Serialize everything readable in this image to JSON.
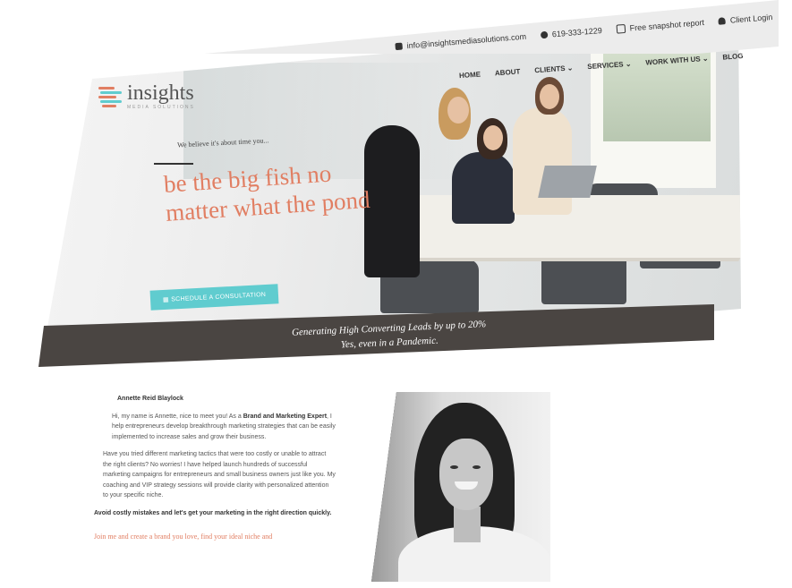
{
  "topbar": {
    "email": "info@insightsmediasolutions.com",
    "phone": "619-333-1229",
    "snapshot": "Free snapshot report",
    "login": "Client Login"
  },
  "logo": {
    "name": "insights",
    "sub": "MEDIA SOLUTIONS"
  },
  "nav": [
    "HOME",
    "ABOUT",
    "CLIENTS ⌄",
    "SERVICES ⌄",
    "WORK WITH US ⌄",
    "BLOG"
  ],
  "hero": {
    "small_tagline": "We believe it's about time you...",
    "headline_1": "be the big fish no",
    "headline_2": "matter what the pond",
    "cta": "SCHEDULE A CONSULTATION"
  },
  "band": {
    "line1": "Generating High Converting Leads by up to 20%",
    "line2": "Yes, even in a Pandemic."
  },
  "bio": {
    "name": "Annette Reid Blaylock",
    "p1_a": "Hi, my name is Annette, nice to meet you! As a ",
    "p1_b": "Brand and Marketing Expert",
    "p1_c": ", I help entrepreneurs develop breakthrough marketing strategies that can be easily implemented to increase sales and grow their business.",
    "p2": "Have you tried different marketing tactics that were too costly or unable to attract the right clients? No worries! I have helped launch hundreds of successful marketing campaigns for entrepreneurs and small business owners just like you. My coaching and VIP strategy sessions will provide clarity with personalized attention to your specific niche.",
    "p3": "Avoid costly mistakes and let's get your marketing in the right direction quickly.",
    "cta": "Join me and create a brand you love, find your ideal niche and"
  },
  "colors": {
    "accent": "#e17e62",
    "cta": "#60cccf",
    "band": "#4a4542"
  }
}
